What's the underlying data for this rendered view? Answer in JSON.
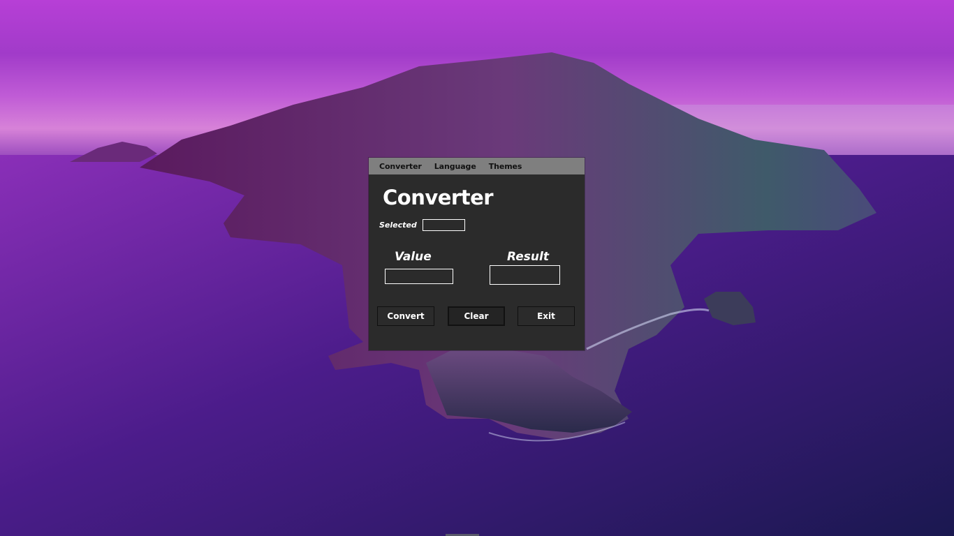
{
  "menu": {
    "items": [
      "Converter",
      "Language",
      "Themes"
    ]
  },
  "app": {
    "title": "Converter",
    "selected_label": "Selected",
    "selected_value": "",
    "value_label": "Value",
    "value_input": "",
    "result_label": "Result",
    "result_value": ""
  },
  "buttons": {
    "convert": "Convert",
    "clear": "Clear",
    "exit": "Exit"
  },
  "colors": {
    "window_bg": "#2b2b2b",
    "menubar_bg": "#7f7f7f",
    "text": "#ffffff"
  }
}
